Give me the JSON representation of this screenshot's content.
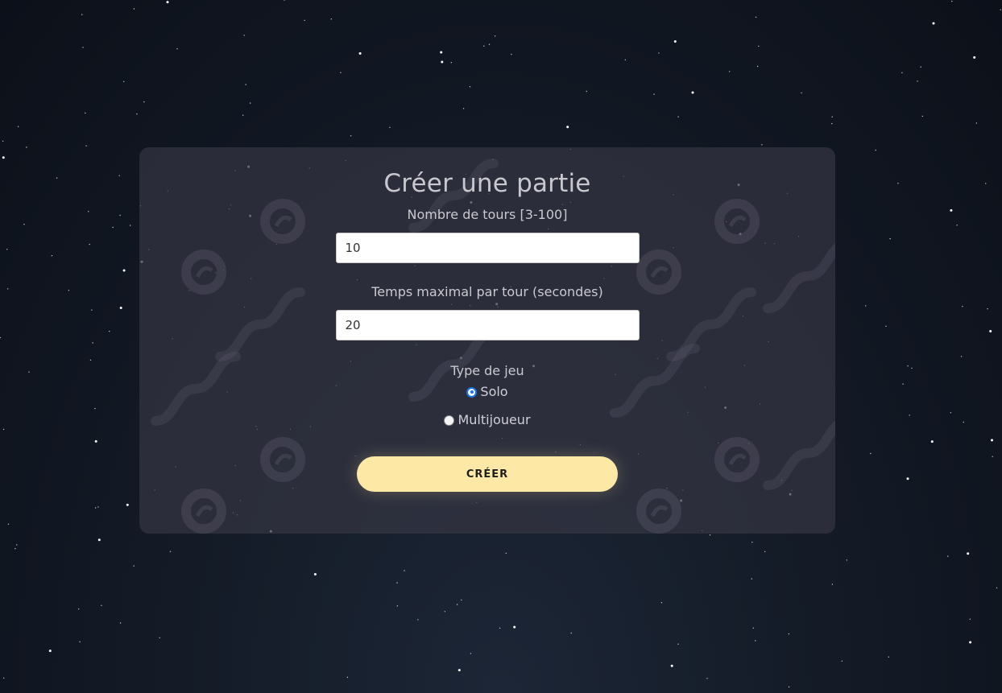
{
  "form": {
    "title": "Créer une partie",
    "rounds_label": "Nombre de tours [3-100]",
    "rounds_value": "10",
    "time_label": "Temps maximal par tour (secondes)",
    "time_value": "20",
    "game_type_label": "Type de jeu",
    "options": {
      "solo": {
        "label": "Solo",
        "checked": true
      },
      "multi": {
        "label": "Multijoueur",
        "checked": false
      }
    },
    "create_label": "CRÉER"
  },
  "colors": {
    "accent": "#fde9a5",
    "radio_selected": "#1a73e8"
  }
}
